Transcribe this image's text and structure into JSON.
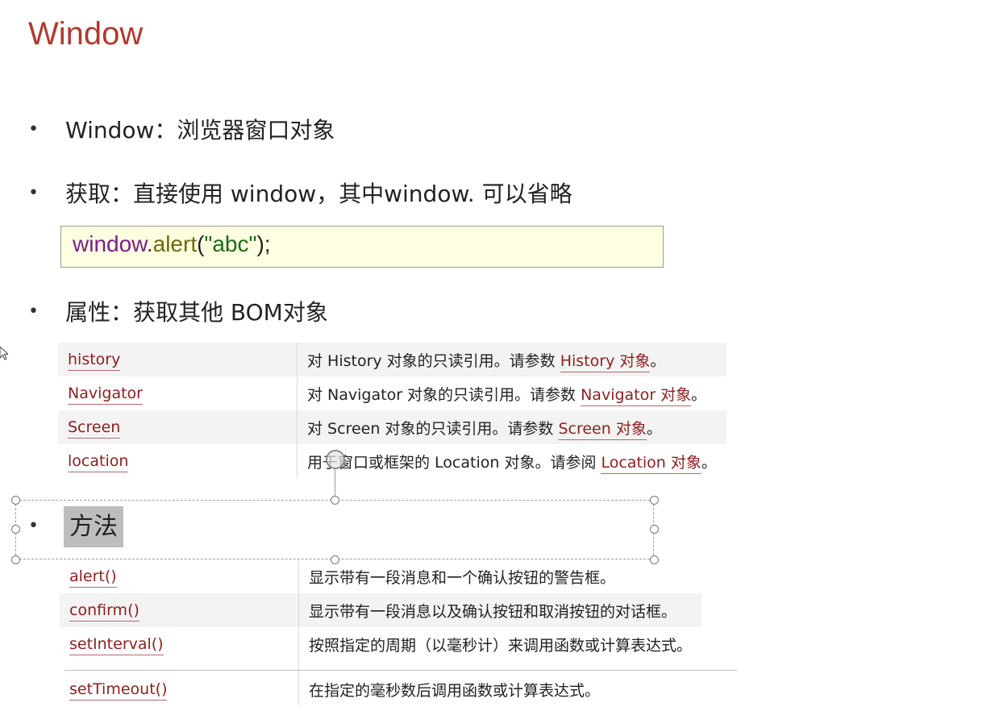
{
  "title": "Window",
  "bullets": {
    "b1": "Window：浏览器窗口对象",
    "b2": "获取：直接使用 window，其中window. 可以省略",
    "b3": "属性：获取其他 BOM对象",
    "b4": "方法"
  },
  "code": {
    "obj": "window",
    "dot": ".",
    "fn": "alert",
    "open": "(",
    "str": "\"abc\"",
    "close": ");"
  },
  "properties": [
    {
      "name": "history",
      "desc": "对 History 对象的只读引用。请参数 ",
      "link": "History 对象",
      "end": "。"
    },
    {
      "name": "Navigator",
      "desc": "对 Navigator 对象的只读引用。请参数 ",
      "link": "Navigator 对象",
      "end": "。"
    },
    {
      "name": "Screen",
      "desc": "对 Screen 对象的只读引用。请参数 ",
      "link": "Screen 对象",
      "end": "。"
    },
    {
      "name": "location",
      "desc": "用于窗口或框架的 Location 对象。请参阅 ",
      "link": "Location 对象",
      "end": "。"
    }
  ],
  "methods": [
    {
      "name": "alert()",
      "desc": "显示带有一段消息和一个确认按钮的警告框。"
    },
    {
      "name": "confirm()",
      "desc": "显示带有一段消息以及确认按钮和取消按钮的对话框。"
    },
    {
      "name": "setInterval()",
      "desc": "按照指定的周期（以毫秒计）来调用函数或计算表达式。"
    },
    {
      "name": "setTimeout()",
      "desc": "在指定的毫秒数后调用函数或计算表达式。"
    }
  ],
  "bullet_glyph": "•"
}
